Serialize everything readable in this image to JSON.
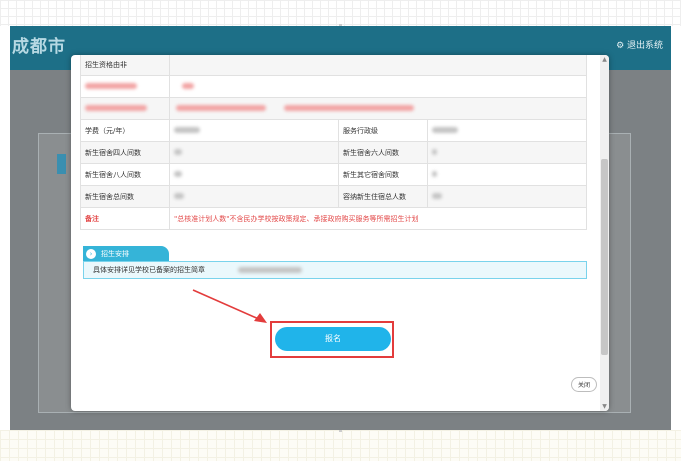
{
  "background_page": {
    "title": "成都市",
    "logout_label": "⚙ 退出系统"
  },
  "modal": {
    "close_icon": "✕",
    "rows": [
      {
        "l1": "招生资格由非",
        "v1": "",
        "l2": "",
        "v2": ""
      },
      {
        "l1": "",
        "v1": "",
        "l2": "",
        "v2": ""
      },
      {
        "l1": "",
        "v1": "",
        "l2": "",
        "v2": ""
      },
      {
        "l1": "学费（元/年）",
        "v1": "",
        "l2": "服务行政级",
        "v2": ""
      },
      {
        "l1": "新生宿舍四人间数",
        "v1": "",
        "l2": "新生宿舍六人间数",
        "v2": ""
      },
      {
        "l1": "新生宿舍八人间数",
        "v1": "",
        "l2": "新生其它宿舍间数",
        "v2": ""
      },
      {
        "l1": "新生宿舍总间数",
        "v1": "",
        "l2": "容纳新生住宿总人数",
        "v2": ""
      }
    ],
    "note_label": "备注",
    "note_text": "\"总核准计划人数\"不含民办学校按政策规定、承接政府购买服务等所需招生计划",
    "section_title": "招生安排",
    "section_text": "具体安排详见学校已备案的招生简章",
    "apply_label": "报名",
    "close_label": "关闭"
  },
  "colors": {
    "header_teal": "#1d6f87",
    "accent_blue": "#20b4ea",
    "highlight_red": "#e33c3c",
    "note_red": "#e34a4a"
  }
}
